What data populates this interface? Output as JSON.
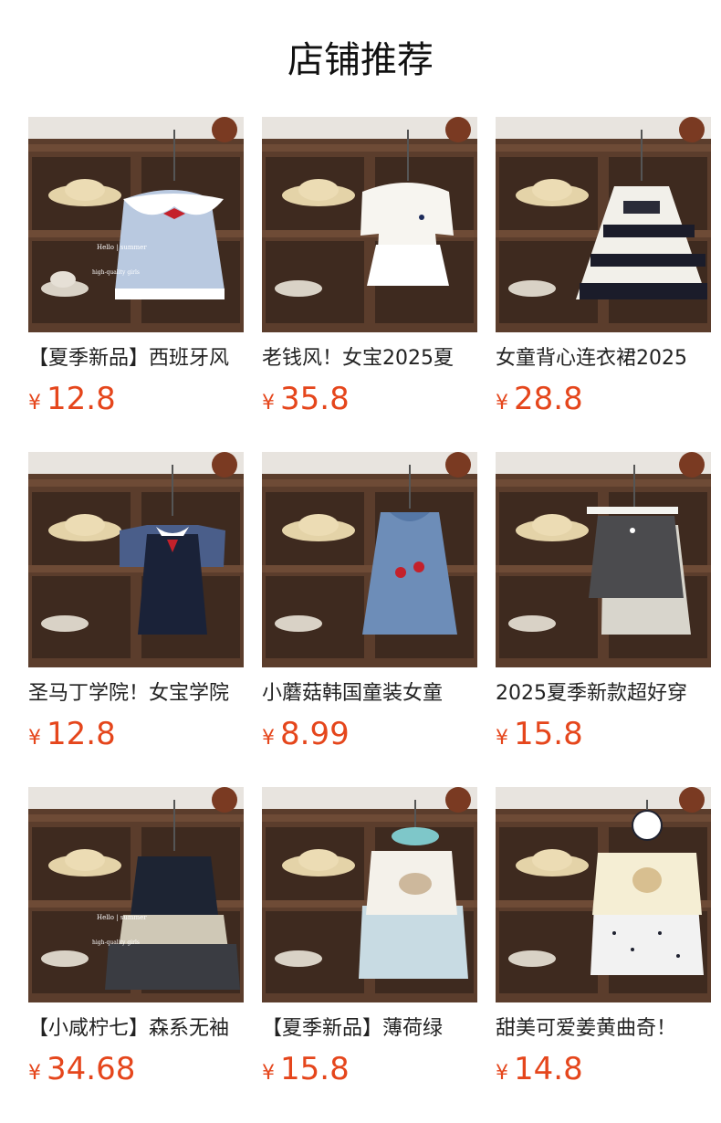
{
  "header": {
    "title": "店铺推荐"
  },
  "currency_symbol": "¥",
  "colors": {
    "price": "#e5461c",
    "shelf": "#5a3f2e"
  },
  "products": [
    {
      "name": "【夏季新品】西班牙风",
      "price": "12.8",
      "photo_text": [
        "Hello | summer",
        "high-quality girls"
      ]
    },
    {
      "name": "老钱风！女宝2025夏",
      "price": "35.8"
    },
    {
      "name": "女童背心连衣裙2025",
      "price": "28.8"
    },
    {
      "name": "圣马丁学院！女宝学院",
      "price": "12.8"
    },
    {
      "name": "小蘑菇韩国童装女童",
      "price": "8.99"
    },
    {
      "name": "2025夏季新款超好穿",
      "price": "15.8"
    },
    {
      "name": "【小咸柠七】森系无袖",
      "price": "34.68",
      "photo_text": [
        "Hello | summer",
        "high-quality girls"
      ]
    },
    {
      "name": "【夏季新品】薄荷绿",
      "price": "15.8"
    },
    {
      "name": "甜美可爱姜黄曲奇！",
      "price": "14.8"
    }
  ]
}
